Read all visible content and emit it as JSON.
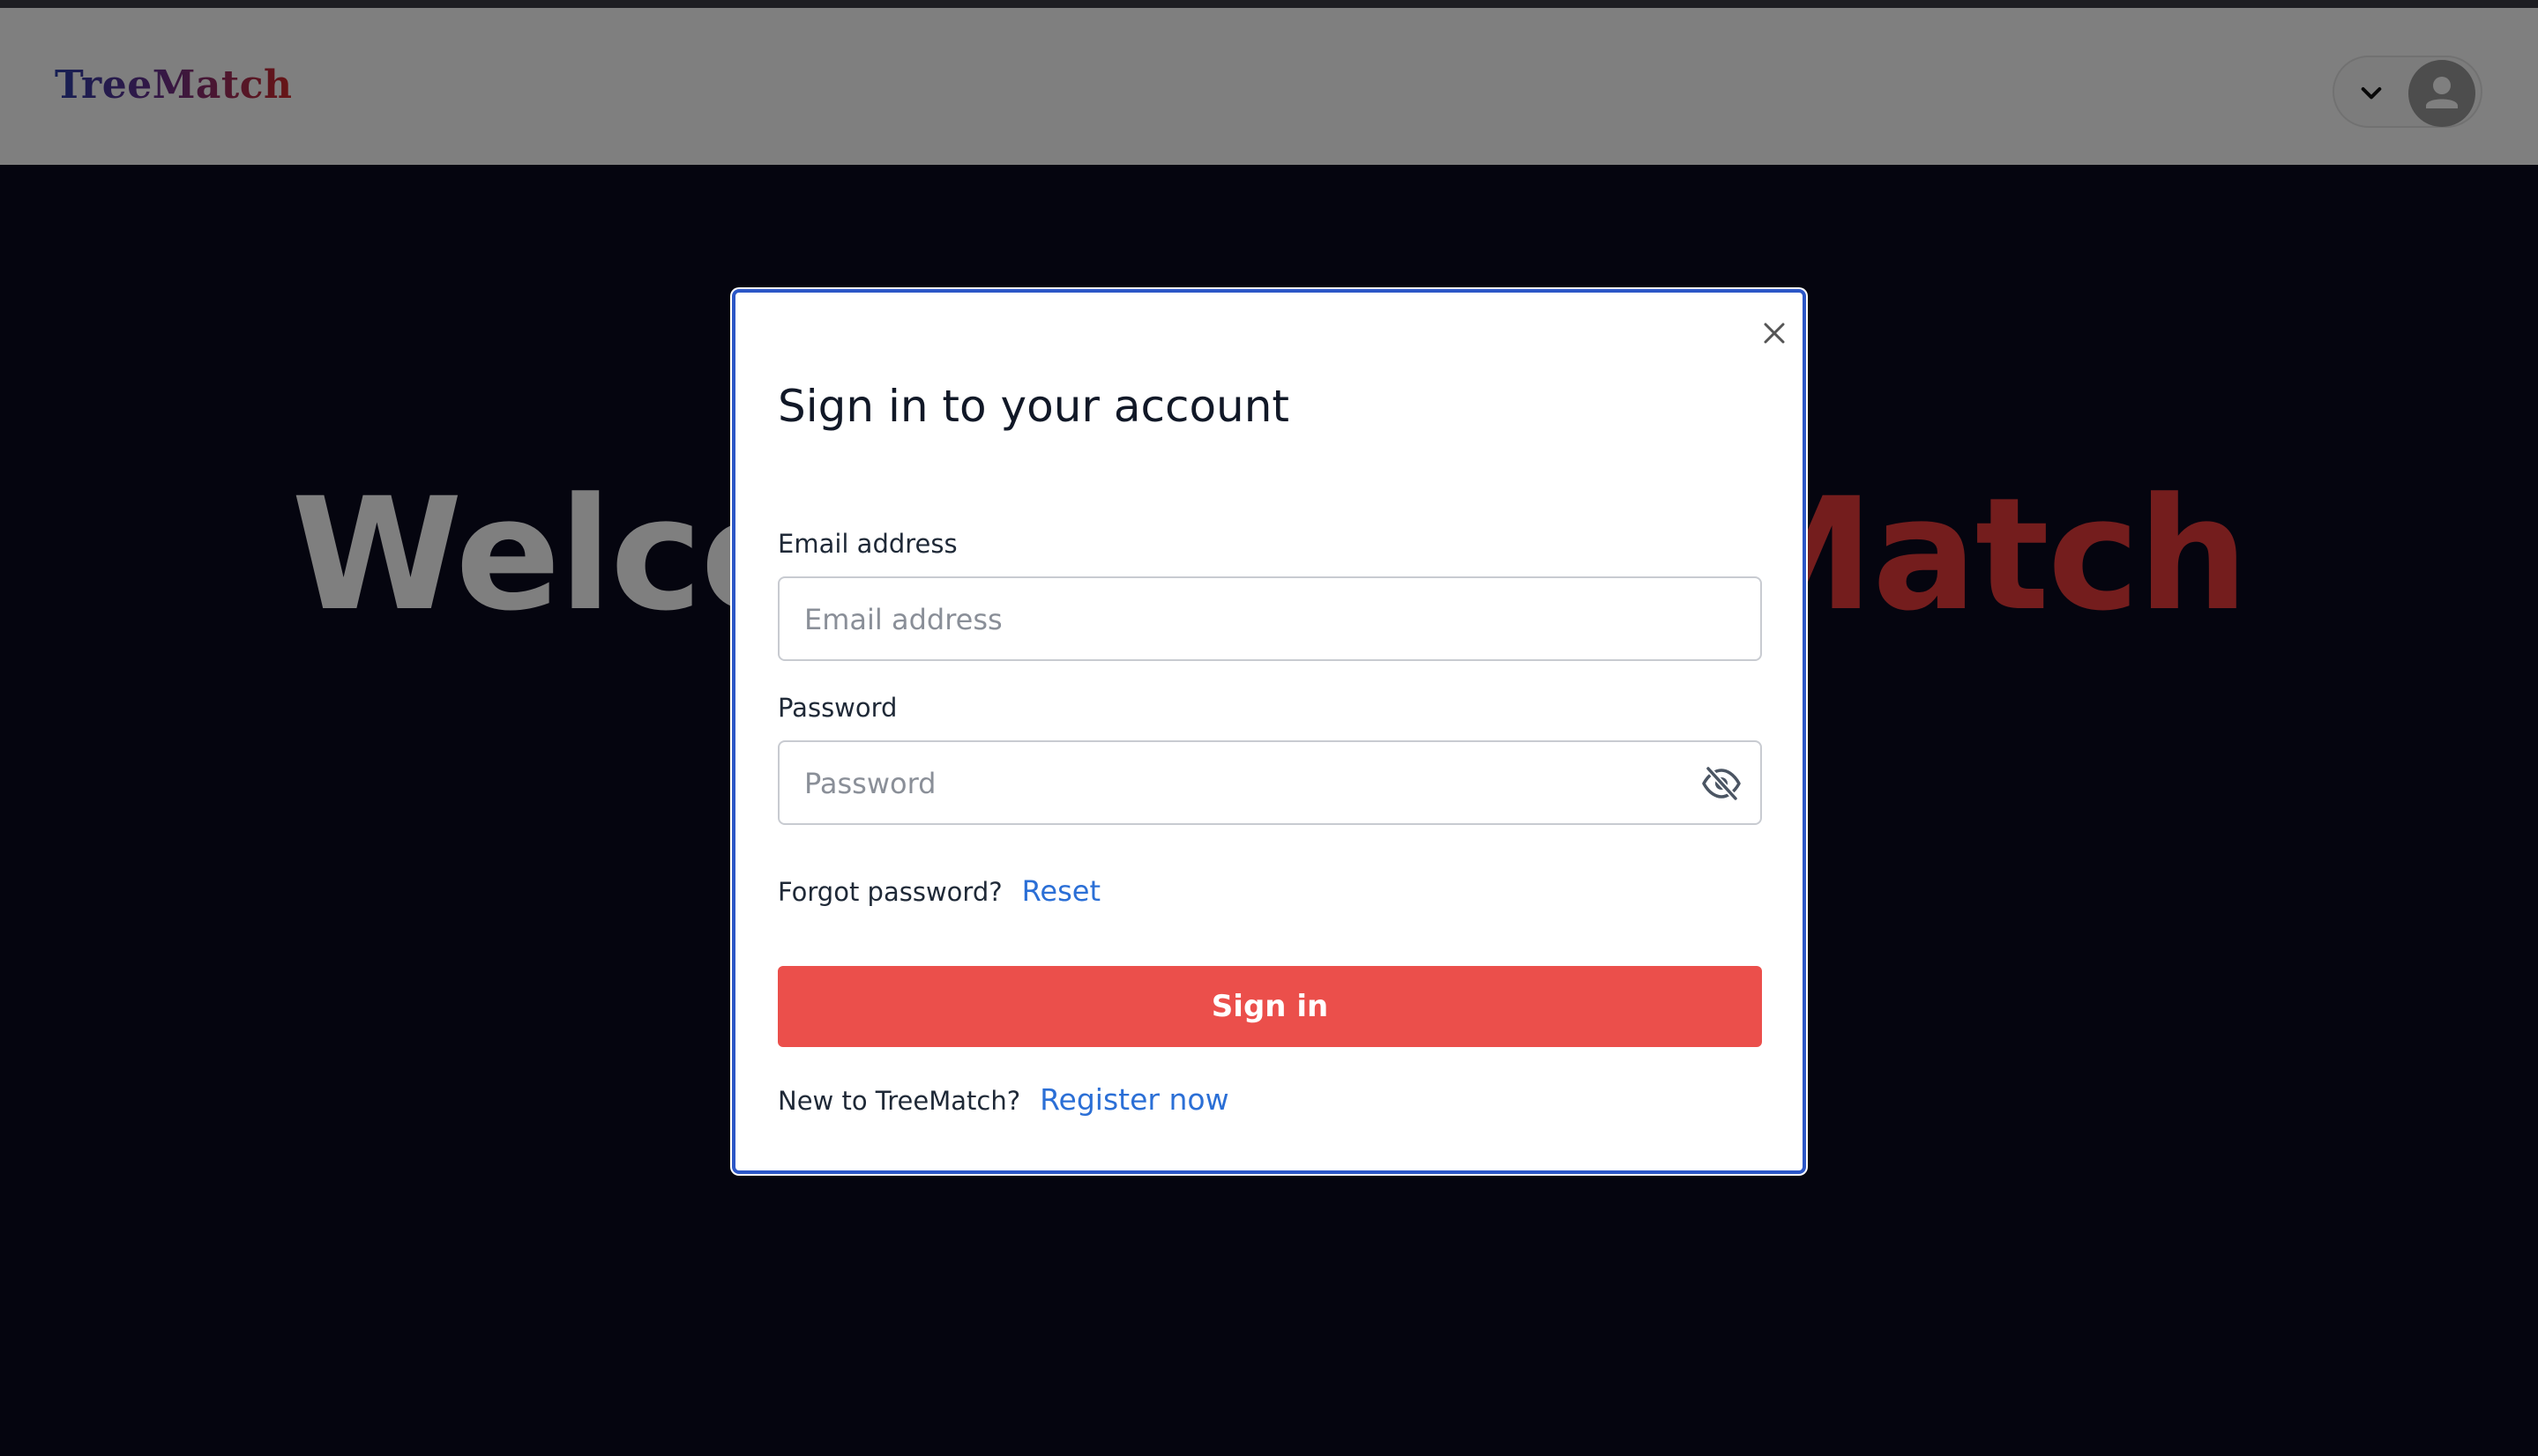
{
  "navbar": {
    "brand": "TreeMatch"
  },
  "hero": {
    "title_part1": "Welcome to Tree",
    "title_part2": "Match"
  },
  "modal": {
    "title": "Sign in to your account",
    "email": {
      "label": "Email address",
      "placeholder": "Email address",
      "value": ""
    },
    "password": {
      "label": "Password",
      "placeholder": "Password",
      "value": ""
    },
    "forgot": {
      "prompt": "Forgot password?",
      "link": "Reset"
    },
    "signin_label": "Sign in",
    "register": {
      "prompt": "New to TreeMatch?",
      "link": "Register now"
    }
  },
  "icons": {
    "close": "close-icon",
    "eye": "eye-off-icon",
    "chevron": "chevron-down-icon",
    "avatar": "user-icon"
  },
  "colors": {
    "page_background": "#0a0a1f",
    "modal_border": "#2c57c7",
    "primary_button": "#eb4f4b",
    "link": "#2b6fd6",
    "brand_accent": "#d12a2a"
  }
}
